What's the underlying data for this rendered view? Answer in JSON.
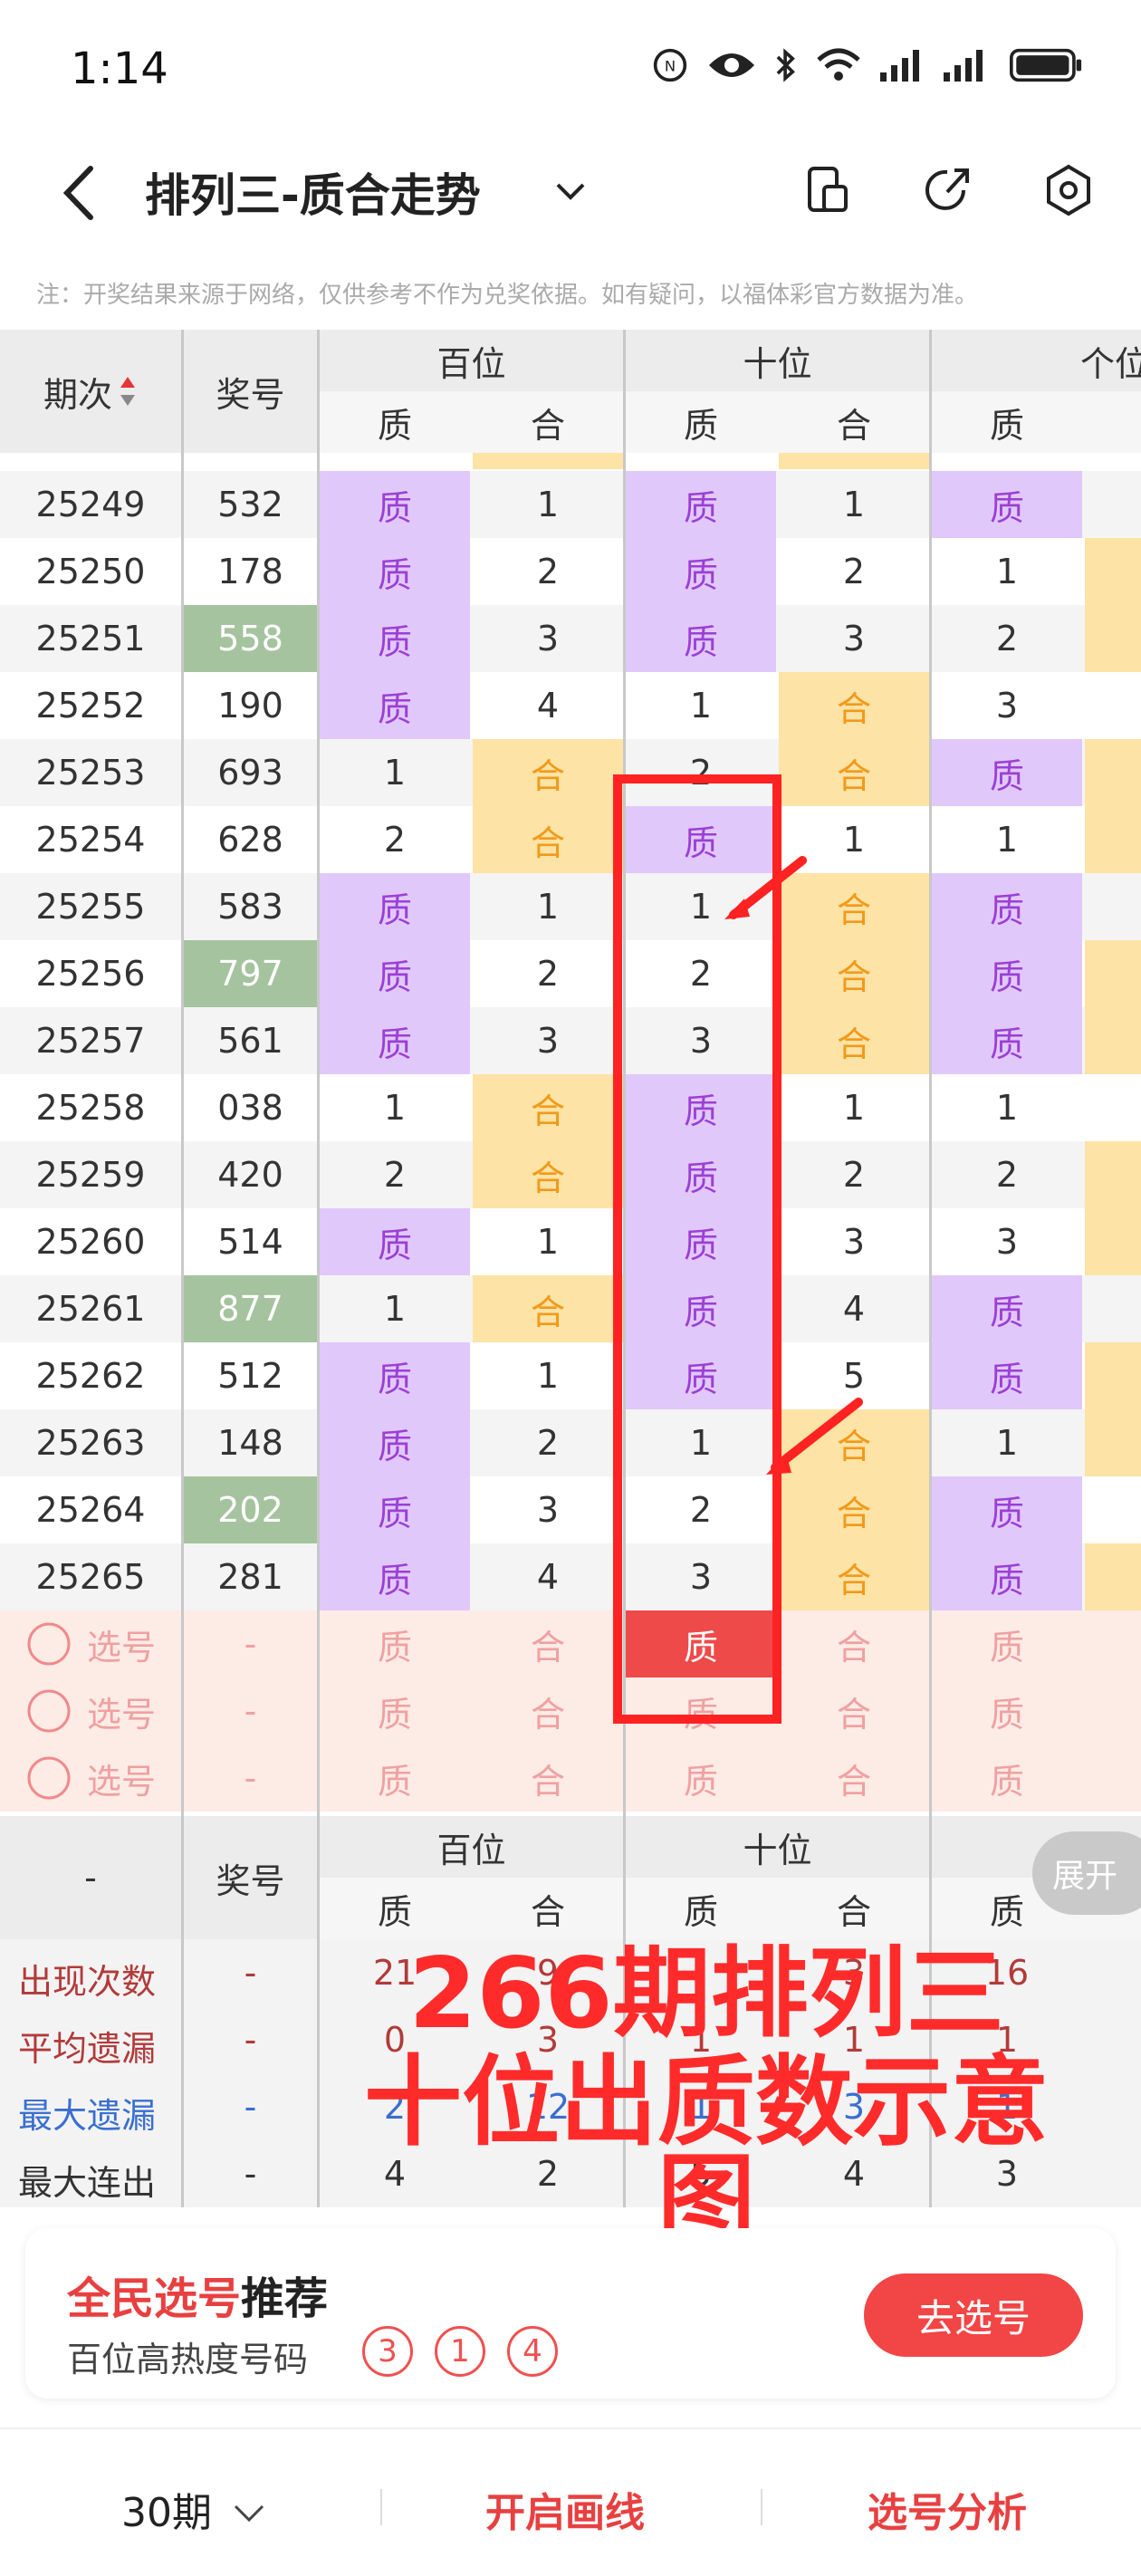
{
  "status": {
    "time": "1:14"
  },
  "header": {
    "title": "排列三-质合走势"
  },
  "notice": "注：开奖结果来源于网络，仅供参考不作为兑奖依据。如有疑问，以福体彩官方数据为准。",
  "table_header": {
    "period": "期次",
    "number": "奖号",
    "groups": [
      "百位",
      "十位",
      "个位"
    ],
    "sub": [
      "质",
      "合",
      "质",
      "合",
      "质"
    ]
  },
  "rows": [
    {
      "p": "25249",
      "n": "532",
      "c": [
        "质",
        "1",
        "质",
        "1",
        "质"
      ],
      "hl": false
    },
    {
      "p": "25250",
      "n": "178",
      "c": [
        "质",
        "2",
        "质",
        "2",
        "1"
      ],
      "hl": false
    },
    {
      "p": "25251",
      "n": "558",
      "c": [
        "质",
        "3",
        "质",
        "3",
        "2"
      ],
      "hl": true
    },
    {
      "p": "25252",
      "n": "190",
      "c": [
        "质",
        "4",
        "1",
        "合",
        "3"
      ],
      "hl": false
    },
    {
      "p": "25253",
      "n": "693",
      "c": [
        "1",
        "合",
        "2",
        "合",
        "质"
      ],
      "hl": false
    },
    {
      "p": "25254",
      "n": "628",
      "c": [
        "2",
        "合",
        "质",
        "1",
        "1"
      ],
      "hl": false
    },
    {
      "p": "25255",
      "n": "583",
      "c": [
        "质",
        "1",
        "1",
        "合",
        "质"
      ],
      "hl": false
    },
    {
      "p": "25256",
      "n": "797",
      "c": [
        "质",
        "2",
        "2",
        "合",
        "质"
      ],
      "hl": true
    },
    {
      "p": "25257",
      "n": "561",
      "c": [
        "质",
        "3",
        "3",
        "合",
        "质"
      ],
      "hl": false
    },
    {
      "p": "25258",
      "n": "038",
      "c": [
        "1",
        "合",
        "质",
        "1",
        "1"
      ],
      "hl": false
    },
    {
      "p": "25259",
      "n": "420",
      "c": [
        "2",
        "合",
        "质",
        "2",
        "2"
      ],
      "hl": false
    },
    {
      "p": "25260",
      "n": "514",
      "c": [
        "质",
        "1",
        "质",
        "3",
        "3"
      ],
      "hl": false
    },
    {
      "p": "25261",
      "n": "877",
      "c": [
        "1",
        "合",
        "质",
        "4",
        "质"
      ],
      "hl": true
    },
    {
      "p": "25262",
      "n": "512",
      "c": [
        "质",
        "1",
        "质",
        "5",
        "质"
      ],
      "hl": false
    },
    {
      "p": "25263",
      "n": "148",
      "c": [
        "质",
        "2",
        "1",
        "合",
        "1"
      ],
      "hl": false
    },
    {
      "p": "25264",
      "n": "202",
      "c": [
        "质",
        "3",
        "2",
        "合",
        "质"
      ],
      "hl": true
    },
    {
      "p": "25265",
      "n": "281",
      "c": [
        "质",
        "4",
        "3",
        "合",
        "质"
      ],
      "hl": false
    }
  ],
  "pick_rows": {
    "label": "选号",
    "dash": "-",
    "cells": [
      "质",
      "合",
      "质",
      "合",
      "质"
    ]
  },
  "stats_header": {
    "dash": "-",
    "number": "奖号",
    "groups": [
      "百位",
      "十位"
    ],
    "sub": [
      "质",
      "合",
      "质",
      "合",
      "质"
    ]
  },
  "stats": [
    {
      "label": "出现次数",
      "v": [
        "-",
        "21",
        "9",
        "",
        "3",
        "16"
      ],
      "color": "#b23a3a"
    },
    {
      "label": "平均遗漏",
      "v": [
        "-",
        "0",
        "3",
        "1",
        "1",
        "1"
      ],
      "color": "#b23a3a"
    },
    {
      "label": "最大遗漏",
      "v": [
        "-",
        "2",
        "12",
        "1",
        "3",
        "1"
      ],
      "color": "#3a6fd0"
    },
    {
      "label": "最大连出",
      "v": [
        "-",
        "4",
        "2",
        "5",
        "4",
        "3"
      ],
      "color": "#333333"
    }
  ],
  "overlay": {
    "line1": "266期排列三",
    "line2": "十位出质数示意图"
  },
  "expand": "展开",
  "card": {
    "title_a": "全民选号",
    "title_b": "推荐",
    "sub": "百位高热度号码",
    "balls": [
      "3",
      "1",
      "4"
    ],
    "button": "去选号"
  },
  "bottom": {
    "periods": "30期",
    "draw": "开启画线",
    "analysis": "选号分析"
  },
  "colors": {
    "prime_bg": "#e1c8fb",
    "composite_bg": "#fde3a5",
    "accent": "#f24545"
  }
}
